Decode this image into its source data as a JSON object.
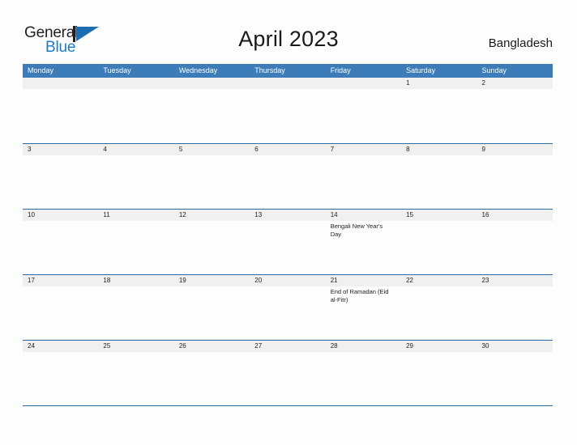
{
  "brand": {
    "name_part1": "General",
    "name_part2": "Blue",
    "mark_icon": "triangle-flag-icon",
    "accent_color": "#1b7ad1",
    "dark_color": "#231f20"
  },
  "header": {
    "title": "April 2023",
    "country": "Bangladesh"
  },
  "calendar": {
    "header_bg_color": "#3b7cb9",
    "row_rule_color": "#2a6ba8",
    "date_strip_color": "#f0f0f0",
    "weekdays": [
      "Monday",
      "Tuesday",
      "Wednesday",
      "Thursday",
      "Friday",
      "Saturday",
      "Sunday"
    ],
    "weeks": [
      {
        "days": [
          {
            "date": "",
            "events": []
          },
          {
            "date": "",
            "events": []
          },
          {
            "date": "",
            "events": []
          },
          {
            "date": "",
            "events": []
          },
          {
            "date": "",
            "events": []
          },
          {
            "date": "1",
            "events": []
          },
          {
            "date": "2",
            "events": []
          }
        ]
      },
      {
        "days": [
          {
            "date": "3",
            "events": []
          },
          {
            "date": "4",
            "events": []
          },
          {
            "date": "5",
            "events": []
          },
          {
            "date": "6",
            "events": []
          },
          {
            "date": "7",
            "events": []
          },
          {
            "date": "8",
            "events": []
          },
          {
            "date": "9",
            "events": []
          }
        ]
      },
      {
        "days": [
          {
            "date": "10",
            "events": []
          },
          {
            "date": "11",
            "events": []
          },
          {
            "date": "12",
            "events": []
          },
          {
            "date": "13",
            "events": []
          },
          {
            "date": "14",
            "events": [
              "Bengali New Year's Day"
            ]
          },
          {
            "date": "15",
            "events": []
          },
          {
            "date": "16",
            "events": []
          }
        ]
      },
      {
        "days": [
          {
            "date": "17",
            "events": []
          },
          {
            "date": "18",
            "events": []
          },
          {
            "date": "19",
            "events": []
          },
          {
            "date": "20",
            "events": []
          },
          {
            "date": "21",
            "events": [
              "End of Ramadan (Eid al-Fitr)"
            ]
          },
          {
            "date": "22",
            "events": []
          },
          {
            "date": "23",
            "events": []
          }
        ]
      },
      {
        "days": [
          {
            "date": "24",
            "events": []
          },
          {
            "date": "25",
            "events": []
          },
          {
            "date": "26",
            "events": []
          },
          {
            "date": "27",
            "events": []
          },
          {
            "date": "28",
            "events": []
          },
          {
            "date": "29",
            "events": []
          },
          {
            "date": "30",
            "events": []
          }
        ]
      }
    ]
  }
}
